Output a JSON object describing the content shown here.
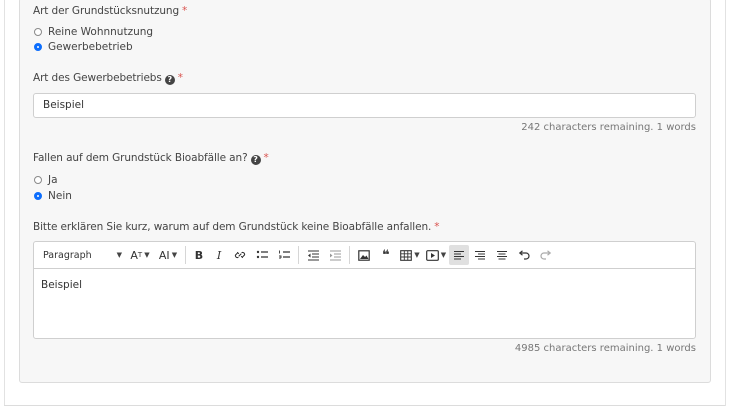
{
  "usage_field": {
    "label": "Art der Grundstücksnutzung",
    "required_mark": "*",
    "options": [
      {
        "label": "Reine Wohnnutzung",
        "checked": false
      },
      {
        "label": "Gewerbebetrieb",
        "checked": true
      }
    ]
  },
  "business_field": {
    "label": "Art des Gewerbebetriebs",
    "help_icon": "?",
    "required_mark": "*",
    "value": "Beispiel",
    "counter": "242 characters remaining. 1 words"
  },
  "bio_field": {
    "label": "Fallen auf dem Grundstück Bioabfälle an?",
    "help_icon": "?",
    "required_mark": "*",
    "options": [
      {
        "label": "Ja",
        "checked": false
      },
      {
        "label": "Nein",
        "checked": true
      }
    ]
  },
  "explain_field": {
    "label": "Bitte erklären Sie kurz, warum auf dem Grundstück keine Bioabfälle anfallen.",
    "required_mark": "*",
    "toolbar": {
      "paragraph_label": "Paragraph",
      "font_size_label": "A",
      "font_family_label": "AI",
      "bold_label": "B",
      "italic_label": "I",
      "quote_label": "❝"
    },
    "body_text": "Beispiel",
    "counter": "4985 characters remaining. 1 words"
  },
  "colors": {
    "accent": "#0d6efd",
    "required": "#d9534f"
  }
}
